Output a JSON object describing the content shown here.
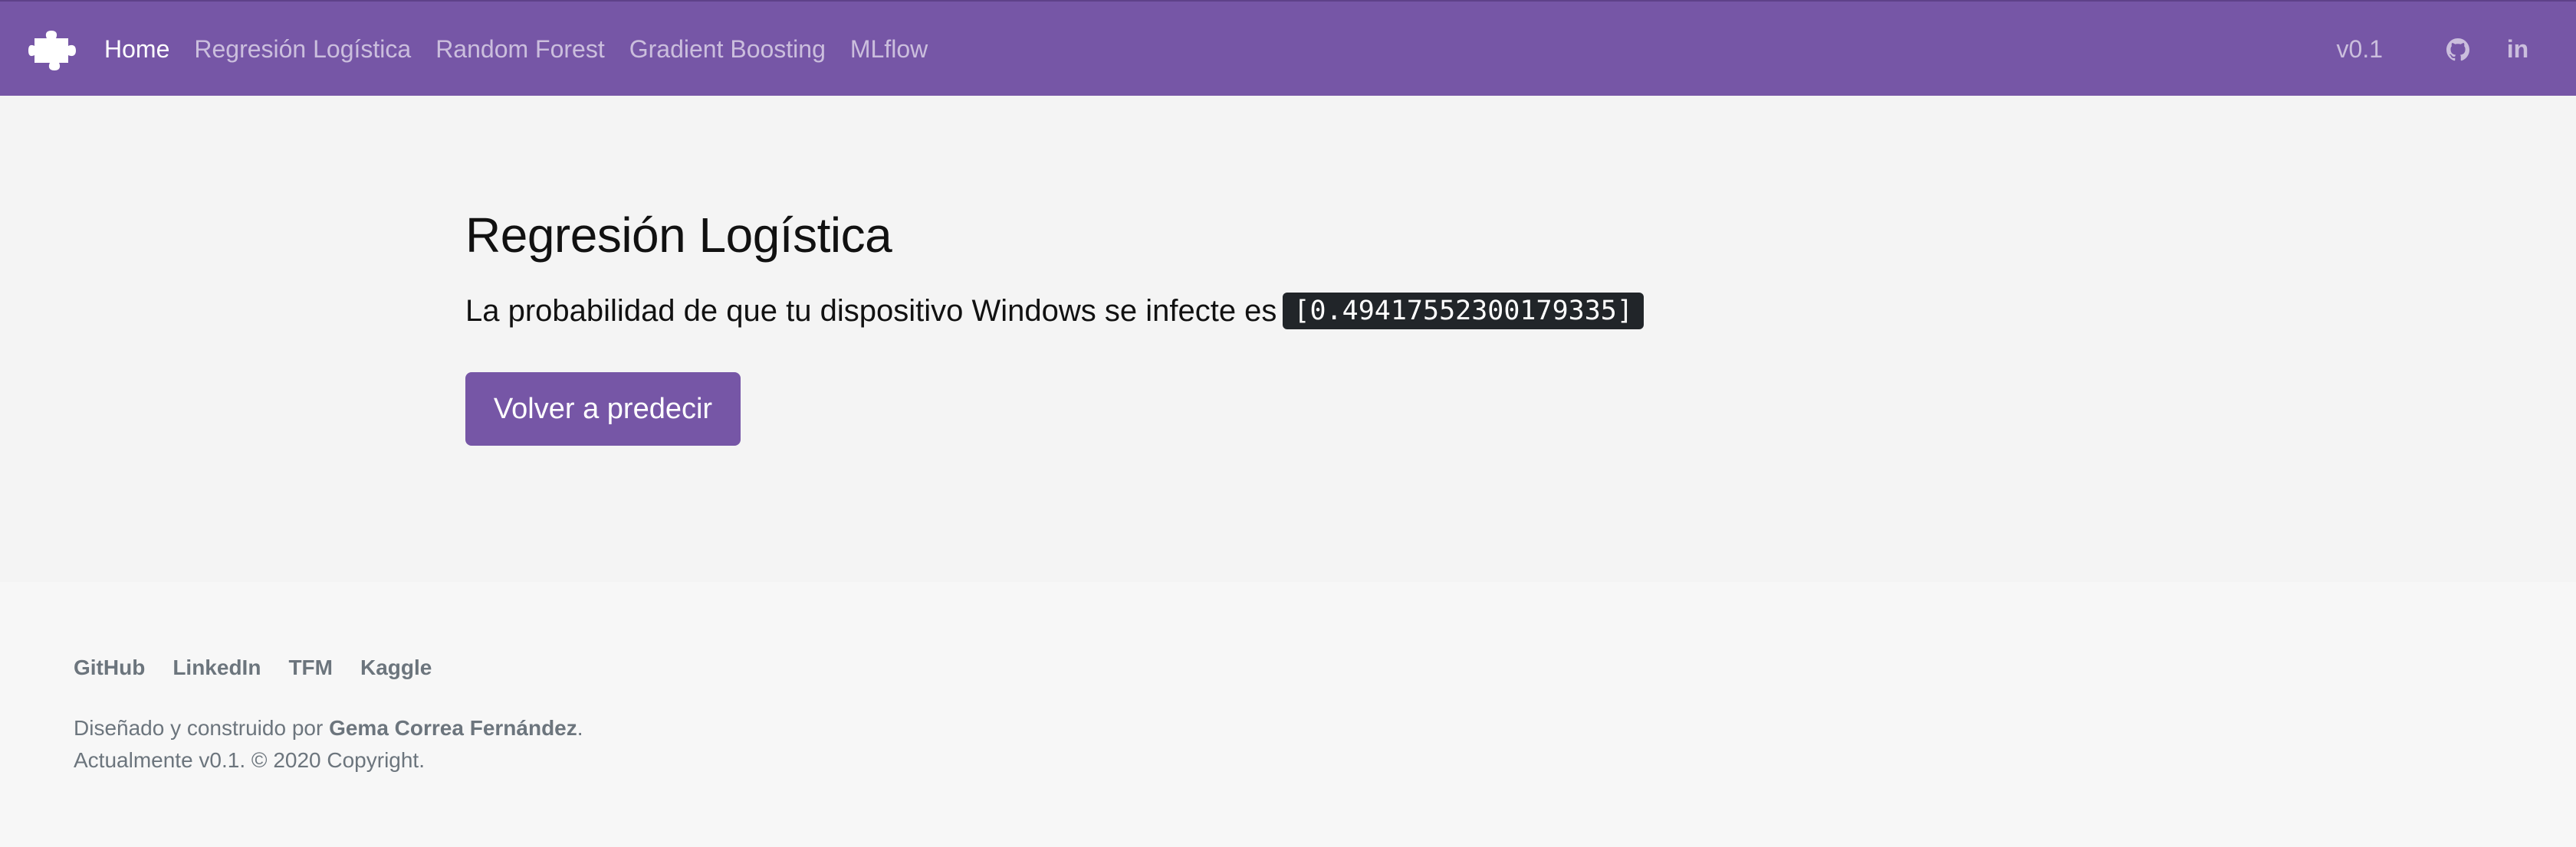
{
  "navbar": {
    "brand_icon": "puzzle-piece-icon",
    "links": [
      {
        "label": "Home",
        "active": true
      },
      {
        "label": "Regresión Logística",
        "active": false
      },
      {
        "label": "Random Forest",
        "active": false
      },
      {
        "label": "Gradient Boosting",
        "active": false
      },
      {
        "label": "MLflow",
        "active": false
      }
    ],
    "version": "v0.1",
    "social_icons": [
      "github-icon",
      "linkedin-icon"
    ],
    "linkedin_text": "in",
    "background_color": "#7656a6"
  },
  "main": {
    "title": "Regresión Logística",
    "result_text": "La probabilidad de que tu dispositivo Windows se infecte es",
    "result_value": "[0.49417552300179335]",
    "button_label": "Volver a predecir"
  },
  "footer": {
    "links": [
      "GitHub",
      "LinkedIn",
      "TFM",
      "Kaggle"
    ],
    "designed_prefix": "Diseñado y construido por",
    "author": "Gema Correa Fernández",
    "designed_suffix": ".",
    "copyright": "Actualmente v0.1. © 2020 Copyright."
  }
}
